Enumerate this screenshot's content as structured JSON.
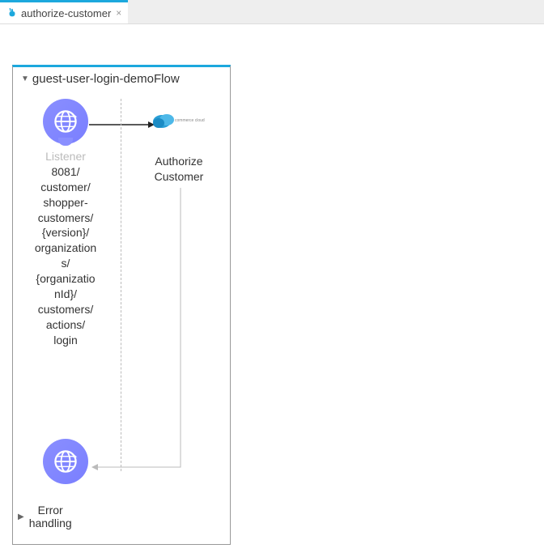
{
  "tab": {
    "title": "authorize-customer",
    "close": "×"
  },
  "flow": {
    "title": "guest-user-login-demoFlow",
    "collapse": "▼",
    "listener": {
      "label": "Listener",
      "details": "8081/\ncustomer/\nshopper-\ncustomers/\n{version}/\norganization\ns/\n{organizatio\nnId}/\ncustomers/\nactions/\nlogin"
    },
    "authorize": {
      "label": "Authorize\nCustomer"
    },
    "errorHandler": {
      "collapse": "▶",
      "label": "Error\nhandling"
    }
  }
}
